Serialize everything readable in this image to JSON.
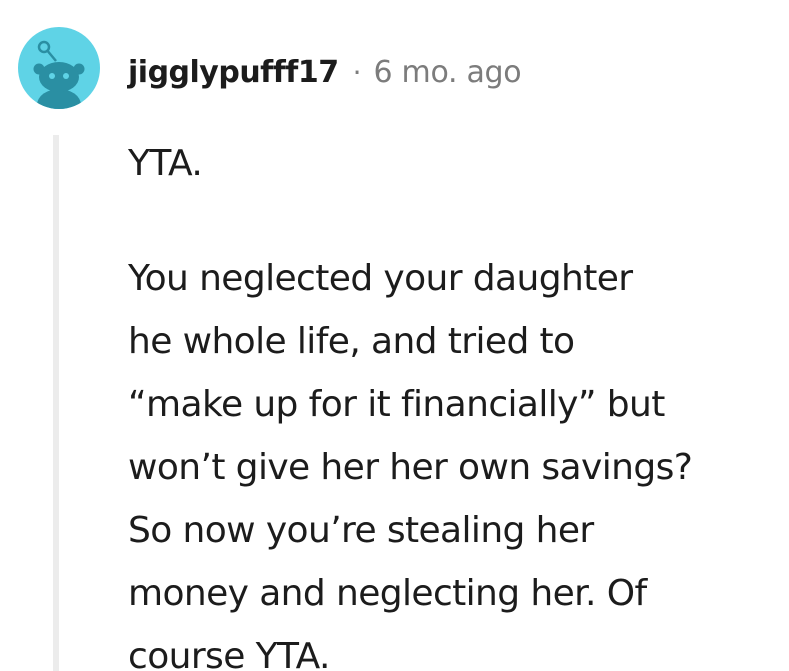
{
  "comment": {
    "username": "jigglypufff17",
    "separator": "·",
    "timestamp": "6 mo. ago",
    "paragraphs": [
      {
        "lines": [
          "YTA."
        ]
      },
      {
        "lines": [
          "You neglected your daughter",
          "he whole life, and tried to",
          "“make up for it financially” but",
          "won’t give her her own savings?",
          "So now you’re stealing her",
          "money and neglecting her. Of",
          "course YTA."
        ]
      }
    ]
  },
  "colors": {
    "avatar_bg": "#5fd3e6",
    "avatar_figure": "#2a8fa3",
    "meta_gray": "#7c7c7c",
    "thread_line": "#ececec",
    "text": "#1c1c1c"
  }
}
